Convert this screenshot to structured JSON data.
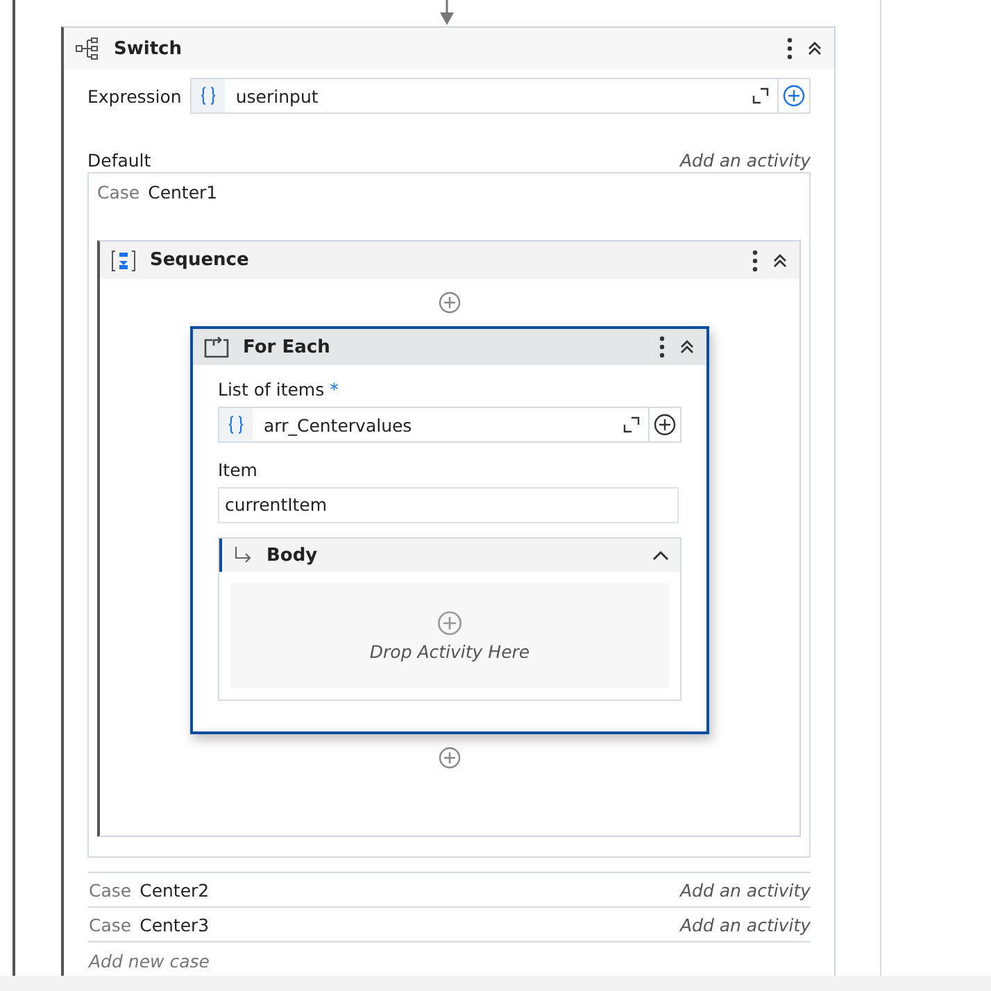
{
  "switch": {
    "title": "Switch",
    "expression_label": "Expression",
    "expression_value": "userinput",
    "default_label": "Default",
    "default_action": "Add an activity",
    "case_label": "Case",
    "first_case": "Center1",
    "sequence": {
      "title": "Sequence",
      "for_each": {
        "title": "For Each",
        "selected": true,
        "list_label": "List of items",
        "required_mark": "*",
        "list_value": "arr_Centervalues",
        "item_label": "Item",
        "item_value": "currentItem",
        "body_title": "Body",
        "drop_hint": "Drop Activity Here"
      }
    },
    "cases": [
      {
        "label": "Case",
        "name": "Center2",
        "action": "Add an activity"
      },
      {
        "label": "Case",
        "name": "Center3",
        "action": "Add an activity"
      }
    ],
    "add_case": "Add new case"
  }
}
